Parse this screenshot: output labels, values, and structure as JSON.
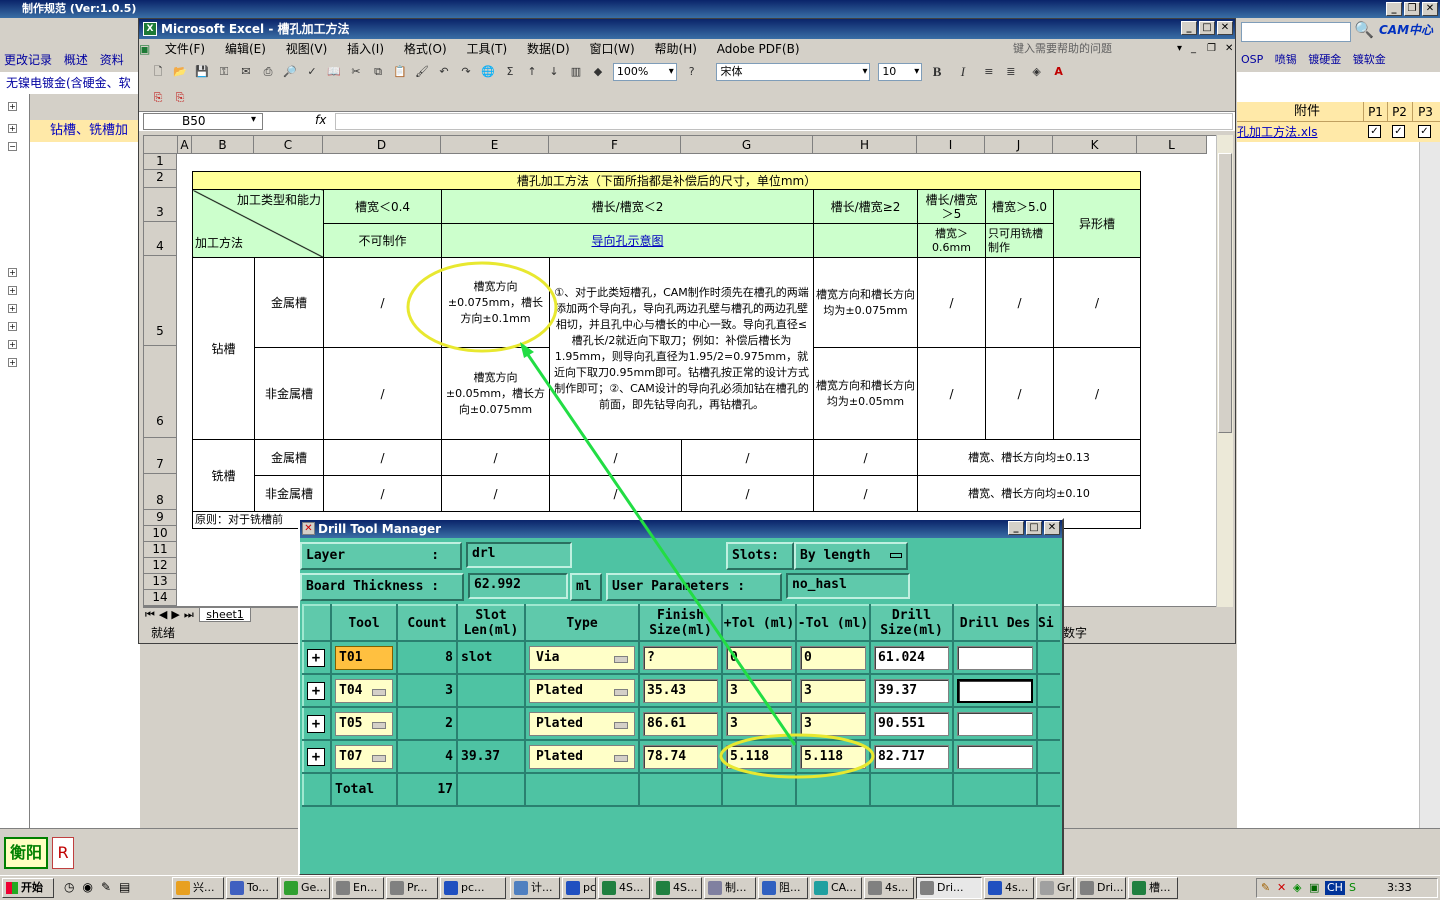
{
  "outer": {
    "title": "制作规范 (Ver:1.0.5)",
    "tabs": [
      "更改记录",
      "概述",
      "资料"
    ],
    "row_label": "无镍电镀金(含硬金、软",
    "selected_row": "钻槽、铣槽加",
    "header_attach": "附件",
    "p_headers": [
      "P1",
      "P2",
      "P3"
    ],
    "file_cell": "孔加工方法.xls",
    "right_tabs": [
      "OSP",
      "喷锡",
      "镀硬金",
      "镀软金"
    ],
    "bottom_label": "衡阳",
    "bottom_r": "R",
    "logo": "CAM中心"
  },
  "excel": {
    "title": "Microsoft Excel - 槽孔加工方法",
    "menus": [
      "文件(F)",
      "编辑(E)",
      "视图(V)",
      "插入(I)",
      "格式(O)",
      "工具(T)",
      "数据(D)",
      "窗口(W)",
      "帮助(H)",
      "Adobe PDF(B)"
    ],
    "help_placeholder": "键入需要帮助的问题",
    "zoom": "100%",
    "font": "宋体",
    "size": "10",
    "bold": "B",
    "italic": "I",
    "cell_ref": "B50",
    "fx": "fx",
    "columns": [
      "A",
      "B",
      "C",
      "D",
      "E",
      "F",
      "G",
      "H",
      "I",
      "J",
      "K",
      "L"
    ],
    "rows": [
      "1",
      "2",
      "3",
      "4",
      "5",
      "6",
      "7",
      "8",
      "9",
      "10",
      "11",
      "12",
      "13",
      "14"
    ],
    "sheet_tab": "sheet1",
    "status": "就绪",
    "status_right": "数字",
    "table": {
      "title": "槽孔加工方法（下面所指都是补偿后的尺寸，单位mm）",
      "hdr_diag_top": "加工类型和能力",
      "hdr_diag_bottom": "加工方法",
      "h_w04": "槽宽＜0.4",
      "h_lw2": "槽长/槽宽＜2",
      "h_lw_ge2": "槽长/槽宽≥2",
      "h_lw5": "槽长/槽宽＞5",
      "h_w50": "槽宽＞5.0",
      "h_irregular": "异形槽",
      "h_cannot": "不可制作",
      "h_link": "导向孔示意图",
      "h_w06": "槽宽＞0.6mm",
      "h_mill_only": "只可用铣槽制作",
      "drill": "钻槽",
      "mill": "铣槽",
      "metal": "金属槽",
      "nonmetal": "非金属槽",
      "slash": "/",
      "e5": "槽宽方向±0.075mm，槽长方向±0.1mm",
      "e6": "槽宽方向±0.05mm，槽长方向±0.075mm",
      "f56": "①、对于此类短槽孔，CAM制作时须先在槽孔的两端添加两个导向孔，导向孔两边孔壁与槽孔的两边孔壁相切，并且孔中心与槽长的中心一致。导向孔直径≤槽孔长/2就近向下取刀；例如：补偿后槽长为1.95mm，则导向孔直径为1.95/2=0.975mm，就近向下取刀0.95mm即可。钻槽孔按正常的设计方式制作即可；②、CAM设计的导向孔必须加钻在槽孔的前面，即先钻导向孔，再钻槽孔。",
      "h5": "槽宽方向和槽长方向均为±0.075mm",
      "h6": "槽宽方向和槽长方向均为±0.05mm",
      "r7": "槽宽、槽长方向均±0.13",
      "r8": "槽宽、槽长方向均±0.10",
      "r9": "原则：对于铣槽前"
    }
  },
  "drill": {
    "title": "Drill Tool Manager",
    "layer_label": "Layer           :",
    "layer_value": "drl",
    "slots_label": "Slots:",
    "slots_value": "By length",
    "board_label": "Board Thickness :",
    "board_value": "62.992",
    "board_unit": "ml",
    "user_label": "User Parameters :",
    "user_value": "no_hasl",
    "headers": [
      "Tool",
      "Count",
      "Slot Len(ml)",
      "Type",
      "Finish Size(ml)",
      "+Tol (ml)",
      "-Tol (ml)",
      "Drill Size(ml)",
      "Drill Des",
      "Si"
    ],
    "rows": [
      {
        "tool": "T01",
        "count": "8",
        "slot": "slot",
        "type": "Via",
        "finish": "?",
        "ptol": "0",
        "mtol": "0",
        "drill": "61.024"
      },
      {
        "tool": "T04",
        "count": "3",
        "slot": "",
        "type": "Plated",
        "finish": "35.43",
        "ptol": "3",
        "mtol": "3",
        "drill": "39.37"
      },
      {
        "tool": "T05",
        "count": "2",
        "slot": "",
        "type": "Plated",
        "finish": "86.61",
        "ptol": "3",
        "mtol": "3",
        "drill": "90.551"
      },
      {
        "tool": "T07",
        "count": "4",
        "slot": "39.37",
        "type": "Plated",
        "finish": "78.74",
        "ptol": "5.118",
        "mtol": "5.118",
        "drill": "82.717"
      }
    ],
    "total_label": "Total",
    "total_count": "17"
  },
  "taskbar": {
    "start": "开始",
    "items": [
      "兴...",
      "To...",
      "Ge...",
      "En...",
      "Pr...",
      "pc...",
      "计...",
      "pc...",
      "4S...",
      "4S...",
      "制...",
      "阻...",
      "CA...",
      "4s...",
      "Dri...",
      "4s...",
      "Gr...",
      "Dri...",
      "槽..."
    ],
    "clock": "3:33",
    "lang": "CH"
  },
  "colors": {
    "accent": "#0a246a",
    "drill_bg": "#4ec3a3",
    "annotation": "#e8e830",
    "arrow": "#22dd44"
  }
}
